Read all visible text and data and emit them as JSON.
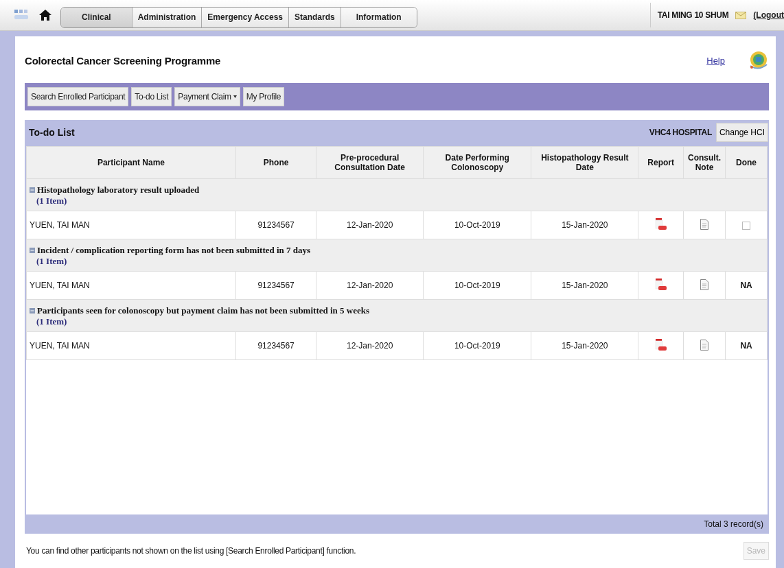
{
  "top_nav": {
    "tabs": [
      {
        "label": "Clinical",
        "selected": true
      },
      {
        "label": "Administration",
        "selected": false
      },
      {
        "label": "Emergency Access",
        "selected": false
      },
      {
        "label": "Standards",
        "selected": false
      },
      {
        "label": "Information",
        "selected": false
      }
    ],
    "user": "TAI MING 10 SHUM",
    "logout": "(Logout"
  },
  "page_title": "Colorectal Cancer Screening Programme",
  "help_link": "Help",
  "toolbar": [
    {
      "label": "Search Enrolled Participant",
      "dropdown": false
    },
    {
      "label": "To-do List",
      "dropdown": false
    },
    {
      "label": "Payment Claim",
      "dropdown": true
    },
    {
      "label": "My Profile",
      "dropdown": false
    }
  ],
  "panel": {
    "title": "To-do List",
    "hospital": "VHC4 HOSPITAL",
    "change_button": "Change HCI"
  },
  "table": {
    "columns": [
      "Participant Name",
      "Phone",
      "Pre-procedural Consultation Date",
      "Date Performing Colonoscopy",
      "Histopathology Result Date",
      "Report",
      "Consult. Note",
      "Done"
    ],
    "groups": [
      {
        "title": "Histopathology laboratory result uploaded",
        "count": "(1 Item)",
        "expanded": true,
        "rows": [
          {
            "name": "YUEN, TAI MAN",
            "phone": "91234567",
            "consultation": "12-Jan-2020",
            "colonoscopy": "10-Oct-2019",
            "result": "15-Jan-2020",
            "done": {
              "kind": "checkbox",
              "checked": false
            }
          }
        ]
      },
      {
        "title": "Incident / complication reporting form has not been submitted in 7 days",
        "count": "(1 Item)",
        "expanded": true,
        "rows": [
          {
            "name": "YUEN, TAI MAN",
            "phone": "91234567",
            "consultation": "12-Jan-2020",
            "colonoscopy": "10-Oct-2019",
            "result": "15-Jan-2020",
            "done": {
              "kind": "text",
              "text": "NA"
            }
          }
        ]
      },
      {
        "title": "Participants seen for colonoscopy but payment claim has not been submitted in 5 weeks",
        "count": "(1 Item)",
        "expanded": true,
        "rows": [
          {
            "name": "YUEN, TAI MAN",
            "phone": "91234567",
            "consultation": "12-Jan-2020",
            "colonoscopy": "10-Oct-2019",
            "result": "15-Jan-2020",
            "done": {
              "kind": "text",
              "text": "NA"
            }
          }
        ]
      }
    ]
  },
  "total": "Total 3 record(s)",
  "note": "You can find other participants not shown on the list using [Search Enrolled Participant] function.",
  "save_button": {
    "label": "Save",
    "disabled": true
  }
}
